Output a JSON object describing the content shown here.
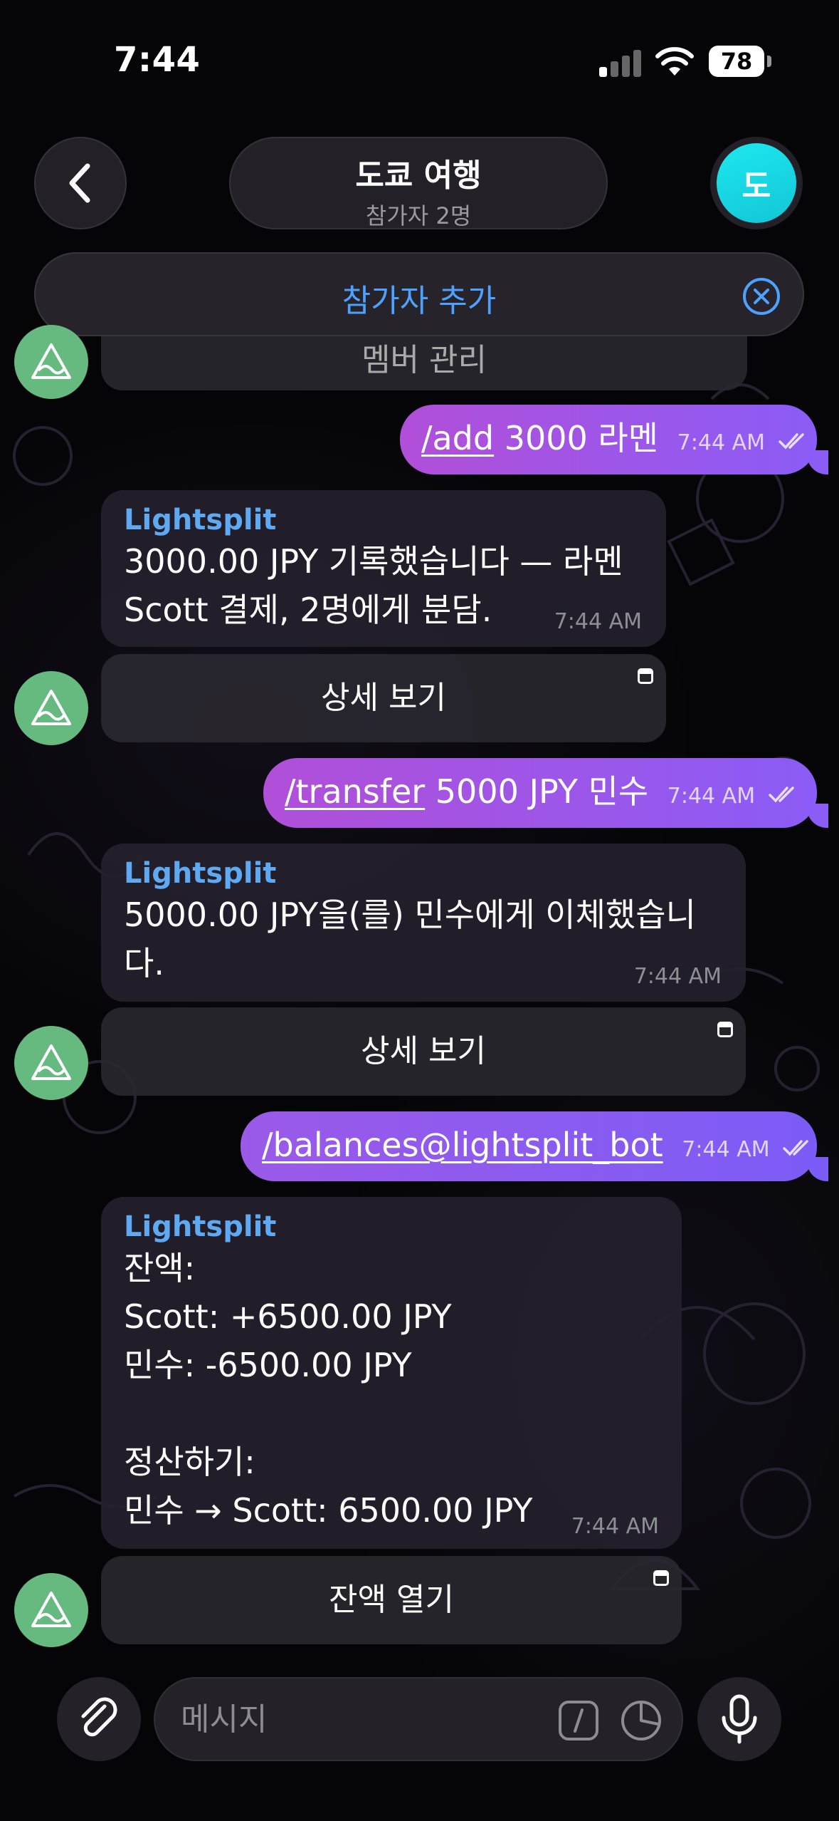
{
  "status_bar": {
    "time": "7:44",
    "battery": "78"
  },
  "header": {
    "title": "도쿄 여행",
    "subtitle": "참가자 2명",
    "avatar_letter": "도",
    "add_participant": "참가자 추가"
  },
  "messages": {
    "partial_button": "멤버 관리",
    "out1": {
      "command": "/add",
      "text": " 3000 라멘",
      "time": "7:44 AM"
    },
    "bot1": {
      "sender": "Lightsplit",
      "line1": "3000.00 JPY 기록했습니다 — 라멘",
      "line2": "Scott 결제, 2명에게 분담.",
      "time": "7:44 AM",
      "button": "상세 보기"
    },
    "out2": {
      "command": "/transfer",
      "text": " 5000 JPY 민수",
      "time": "7:44 AM"
    },
    "bot2": {
      "sender": "Lightsplit",
      "line1": "5000.00 JPY을(를) 민수에게 이체했습니",
      "line2": "다.",
      "time": "7:44 AM",
      "button": "상세 보기"
    },
    "out3": {
      "command": "/balances@lightsplit_bot",
      "time": "7:44 AM"
    },
    "bot3": {
      "sender": "Lightsplit",
      "line1": "잔액:",
      "line2": "Scott: +6500.00 JPY",
      "line3": "민수: -6500.00 JPY",
      "line4": "정산하기:",
      "line5": "민수 → Scott: 6500.00 JPY",
      "time": "7:44 AM",
      "button": "잔액 열기"
    }
  },
  "composer": {
    "placeholder": "메시지"
  },
  "colors": {
    "outgoing_bubble": "#8b5cf6",
    "sender_name": "#5ea9f2",
    "accent_blue": "#4ea2ff",
    "avatar_cyan": "#1ee8ee",
    "bot_avatar": "#66b97f"
  },
  "icons": {
    "back": "chevron-left-icon",
    "close": "close-circle-icon",
    "attach": "paperclip-icon",
    "commands": "slash-command-icon",
    "stickers": "sticker-icon",
    "voice": "microphone-icon",
    "read_receipt": "double-check-icon",
    "inline_button": "open-app-icon"
  }
}
